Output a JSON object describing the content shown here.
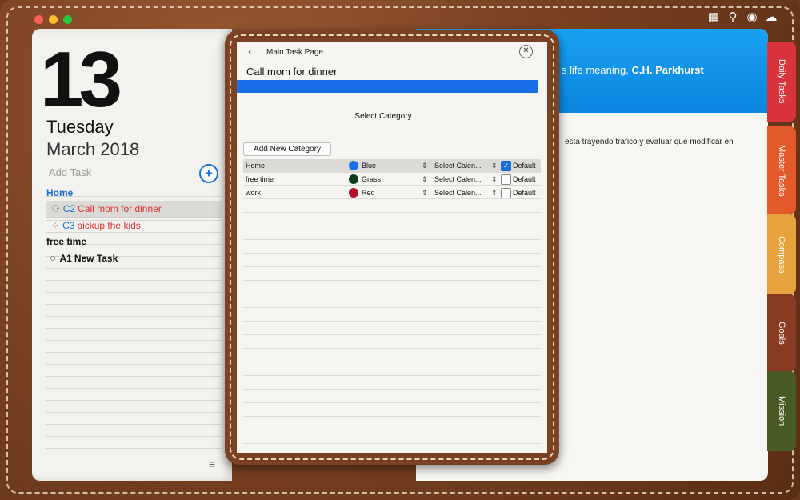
{
  "window": {
    "traffic_lights": [
      "#ff5f57",
      "#febc2e",
      "#28c840"
    ]
  },
  "topbar": {
    "icons": [
      "calendar-check-icon",
      "search-icon",
      "eye-icon",
      "cloud-icon"
    ],
    "glyphs": [
      "▦",
      "⚲",
      "◉",
      "☁"
    ]
  },
  "date": {
    "day_number": "13",
    "weekday": "Tuesday",
    "month_year": "March 2018"
  },
  "tasks": {
    "add_placeholder": "Add Task",
    "add_glyph": "+",
    "groups": [
      {
        "name": "Home",
        "items": [
          {
            "code": "C2",
            "label": "Call mom for dinner",
            "icon": "person-icon",
            "glyph": "⚇"
          },
          {
            "code": "C3",
            "label": "pickup the kids",
            "icon": "dotted-circle-icon",
            "glyph": "⁘"
          }
        ]
      },
      {
        "name": "free time",
        "items": [
          {
            "code": "A1",
            "label": "New Task",
            "icon": "circle-icon",
            "glyph": "○"
          }
        ]
      }
    ],
    "menu_glyph": "≡"
  },
  "right_page": {
    "quote_text": "s life meaning.",
    "quote_author": "C.H. Parkhurst",
    "note": "esta trayendo trafico y evaluar que modificar en"
  },
  "tabs": [
    {
      "label": "Daily Tasks",
      "color": "#d9333b"
    },
    {
      "label": "Master Tasks",
      "color": "#e25a2a"
    },
    {
      "label": "Compass",
      "color": "#e6a23c"
    },
    {
      "label": "Goals",
      "color": "#8a3c22"
    },
    {
      "label": "Mission",
      "color": "#4a5a24"
    }
  ],
  "modal": {
    "back_glyph": "‹",
    "title": "Main Task Page",
    "close_glyph": "✕",
    "task_name": "Call mom for dinner",
    "progress_color": "#1a6fe8",
    "select_category_label": "Select Category",
    "add_category_label": "Add New Category",
    "categories": [
      {
        "name": "Home",
        "color_name": "Blue",
        "color": "#1a6fe8",
        "calendar": "Select Calen...",
        "default": true,
        "default_label": "Default"
      },
      {
        "name": "free time",
        "color_name": "Grass",
        "color": "#0d3b1a",
        "calendar": "Select Calen...",
        "default": false,
        "default_label": "Default"
      },
      {
        "name": "work",
        "color_name": "Red",
        "color": "#b0102a",
        "calendar": "Select Calen...",
        "default": false,
        "default_label": "Default"
      }
    ],
    "updown_glyph": "⇕",
    "check_glyph": "✓"
  }
}
